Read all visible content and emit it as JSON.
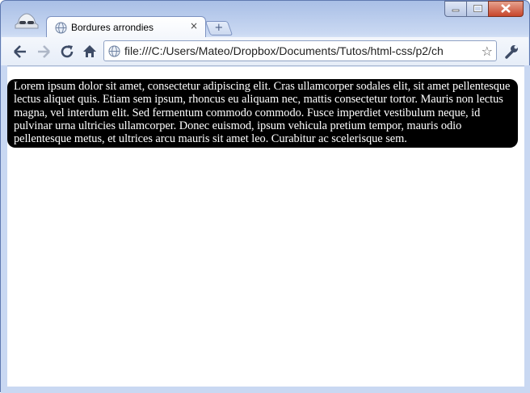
{
  "window": {
    "tab": {
      "title": "Bordures arrondies",
      "close_glyph": "×",
      "favicon": "globe-icon"
    },
    "new_tab_glyph": "+",
    "controls": [
      "minimize-icon",
      "maximize-icon",
      "close-icon"
    ]
  },
  "toolbar": {
    "back_icon": "back-arrow-icon",
    "forward_icon": "forward-arrow-icon",
    "reload_icon": "reload-icon",
    "home_icon": "home-icon",
    "address": "file:///C:/Users/Mateo/Dropbox/Documents/Tutos/html-css/p2/ch",
    "bookmark_icon": "star-icon",
    "menu_icon": "wrench-icon"
  },
  "page": {
    "paragraph": "Lorem ipsum dolor sit amet, consectetur adipiscing elit. Cras ullamcorper sodales elit, sit amet pellentesque lectus aliquet quis. Etiam sem ipsum, rhoncus eu aliquam nec, mattis consectetur tortor. Mauris non lectus magna, vel interdum elit. Sed fermentum commodo commodo. Fusce imperdiet vestibulum neque, id pulvinar urna ultricies ullamcorper. Donec euismod, ipsum vehicula pretium tempor, mauris odio pellentesque metus, et ultrices arcu mauris sit amet leo. Curabitur ac scelerisque sem.",
    "block_background": "#000000",
    "block_text_color": "#ffffff"
  }
}
